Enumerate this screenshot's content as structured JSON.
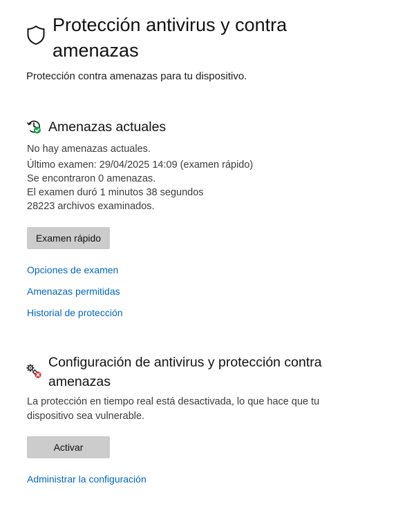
{
  "page": {
    "title": "Protección antivirus y contra amenazas",
    "subtitle": "Protección contra amenazas para tu dispositivo."
  },
  "current_threats": {
    "title": "Amenazas actuales",
    "status": "No hay amenazas actuales.",
    "last_scan": "Último examen: 29/04/2025 14:09 (examen rápido)",
    "threats_found": "Se encontraron 0 amenazas.",
    "duration": "El examen duró 1 minutos 38 segundos",
    "files_scanned": "28223 archivos examinados.",
    "quick_scan_label": "Examen rápido",
    "links": {
      "scan_options": "Opciones de examen",
      "allowed_threats": "Amenazas permitidas",
      "protection_history": "Historial de protección"
    }
  },
  "settings": {
    "title": "Configuración de antivirus y protección contra amenazas",
    "warning_line1": "La protección en tiempo real está desactivada, lo que hace que tu",
    "warning_line2": "dispositivo sea vulnerable.",
    "activate_label": "Activar",
    "manage_link": "Administrar la configuración"
  },
  "colors": {
    "link": "#0067c0",
    "button_bg": "#cccccc",
    "ok_badge": "#16a34a",
    "alert_badge": "#d13438"
  },
  "icons": {
    "page": "shield-icon",
    "current_threats": "clock-refresh-check-icon",
    "settings": "gears-alert-icon"
  }
}
